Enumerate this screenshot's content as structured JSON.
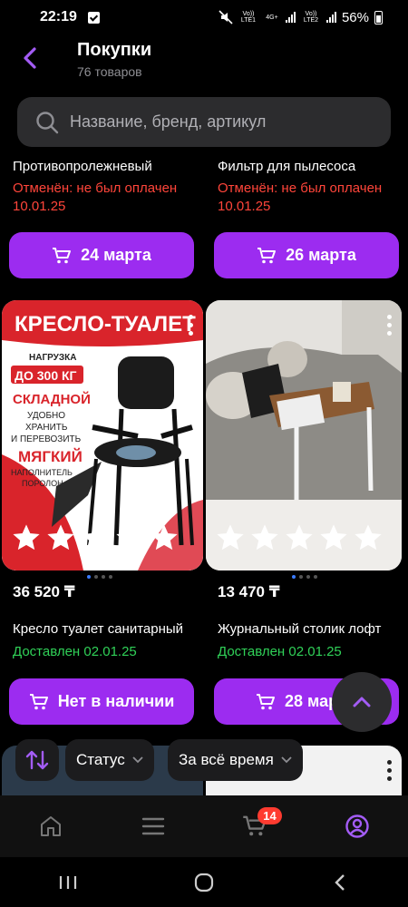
{
  "status_bar": {
    "time": "22:19",
    "battery": "56%",
    "lte1": "Vo)) LTE1",
    "lte2": "Vo)) LTE2",
    "net": "4G+"
  },
  "header": {
    "title": "Покупки",
    "subtitle": "76 товаров"
  },
  "search": {
    "placeholder": "Название, бренд, артикул"
  },
  "row1": [
    {
      "name": "Противопролежневый",
      "status": "Отменён: не был оплачен",
      "date": "10.01.25",
      "button": "24 марта"
    },
    {
      "name": "Фильтр для пылесоса",
      "status": "Отменён: не был оплачен",
      "date": "10.01.25",
      "button": "26 марта"
    }
  ],
  "row2": [
    {
      "image_text": {
        "title": "КРЕСЛО-ТУАЛЕТ",
        "l1": "НАГРУЗКА",
        "l2": "ДО 300 КГ",
        "l3": "СКЛАДНОЙ",
        "l4": "УДОБНО",
        "l5": "ХРАНИТЬ",
        "l6": "И ПЕРЕВОЗИТЬ",
        "l7": "МЯГКИЙ",
        "l8": "НАПОЛНИТЕЛЬ",
        "l9": "ПОРОЛОН"
      },
      "price": "36 520 ₸",
      "name": "Кресло туалет санитарный",
      "status": "Доставлен 02.01.25",
      "button": "Нет в наличии",
      "rating": 0,
      "rating_max": 5
    },
    {
      "price": "13 470 ₸",
      "name": "Журнальный столик лофт",
      "status": "Доставлен 02.01.25",
      "button": "28 марта",
      "rating": 0,
      "rating_max": 5
    }
  ],
  "filters": {
    "status": "Статус",
    "period": "За всё время"
  },
  "tabbar": {
    "cart_badge": "14"
  },
  "colors": {
    "accent": "#9c2cf0",
    "cancelled": "#ff453a",
    "delivered": "#30d158",
    "background": "#000000"
  }
}
